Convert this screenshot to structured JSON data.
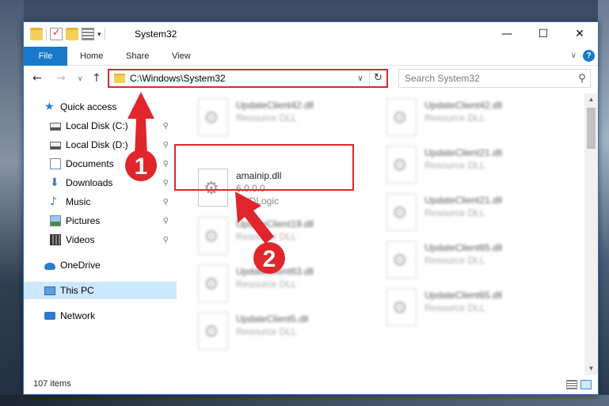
{
  "window": {
    "title": "System32",
    "minimize_glyph": "—",
    "maximize_glyph": "☐",
    "close_glyph": "✕"
  },
  "ribbon": {
    "tabs": [
      "File",
      "Home",
      "Share",
      "View"
    ],
    "expand_glyph": "∨",
    "help_glyph": "?"
  },
  "nav": {
    "back_glyph": "←",
    "forward_glyph": "→",
    "recent_glyph": "∨",
    "up_glyph": "↑",
    "address": "C:\\Windows\\System32",
    "address_dropdown_glyph": "∨",
    "refresh_glyph": "↻",
    "search_placeholder": "Search System32",
    "search_glyph": "⚲"
  },
  "sidebar": {
    "items": [
      {
        "label": "Quick access",
        "icon": "star-icon",
        "pinned": false
      },
      {
        "label": "Local Disk (C:)",
        "icon": "disk-icon",
        "pinned": true
      },
      {
        "label": "Local Disk (D:)",
        "icon": "disk-icon",
        "pinned": true
      },
      {
        "label": "Documents",
        "icon": "documents-icon",
        "pinned": true
      },
      {
        "label": "Downloads",
        "icon": "download-icon",
        "pinned": true
      },
      {
        "label": "Music",
        "icon": "music-icon",
        "pinned": true
      },
      {
        "label": "Pictures",
        "icon": "pictures-icon",
        "pinned": true
      },
      {
        "label": "Videos",
        "icon": "videos-icon",
        "pinned": true
      },
      {
        "label": "OneDrive",
        "icon": "onedrive-icon",
        "pinned": false
      },
      {
        "label": "This PC",
        "icon": "pc-icon",
        "pinned": false,
        "selected": true
      },
      {
        "label": "Network",
        "icon": "network-icon",
        "pinned": false
      }
    ],
    "pin_glyph": "📌"
  },
  "files": [
    {
      "name": "UpdateClient42.dll",
      "line2": "Resource DLL",
      "line3": ""
    },
    {
      "name": "UpdateClient42.dll",
      "line2": "Resource DLL",
      "line3": ""
    },
    {
      "name": "amainip.dll",
      "line2": "6.0.0.0",
      "line3": "DVDLogic"
    },
    {
      "name": "UpdateClient21.dll",
      "line2": "Resource DLL",
      "line3": ""
    },
    {
      "name": "UpdateClient19.dll",
      "line2": "Resource DLL",
      "line3": ""
    },
    {
      "name": "UpdateClient21.dll",
      "line2": "Resource DLL",
      "line3": ""
    },
    {
      "name": "UpdateClient63.dll",
      "line2": "Resource DLL",
      "line3": ""
    },
    {
      "name": "UpdateClient65.dll",
      "line2": "Resource DLL",
      "line3": ""
    },
    {
      "name": "UpdateClient5.dll",
      "line2": "Resource DLL",
      "line3": ""
    },
    {
      "name": "UpdateClient65.dll",
      "line2": "Resource DLL",
      "line3": ""
    }
  ],
  "status": {
    "item_count": "107 items"
  },
  "scrollbar": {
    "up_glyph": "▲",
    "down_glyph": "▼"
  },
  "annotations": {
    "step1": "1",
    "step2": "2",
    "color": "#e0262c"
  },
  "colors": {
    "accent": "#1979ca",
    "selection": "#cce8ff",
    "highlight": "#e0262c"
  }
}
